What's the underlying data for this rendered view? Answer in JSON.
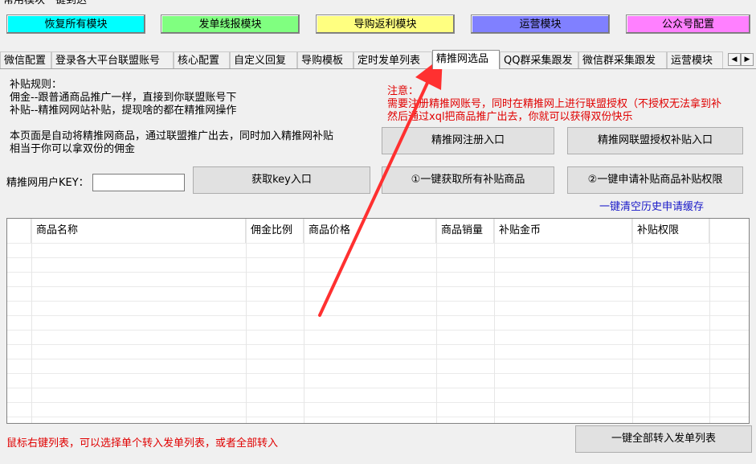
{
  "group_title": "常用模块一键到达",
  "modules": [
    {
      "label": "恢复所有模块",
      "color": "#00ffff"
    },
    {
      "label": "发单线报模块",
      "color": "#80ff80"
    },
    {
      "label": "导购返利模块",
      "color": "#ffff80"
    },
    {
      "label": "运营模块",
      "color": "#8080ff"
    },
    {
      "label": "公众号配置",
      "color": "#ff80ff"
    }
  ],
  "tabs": [
    "微信配置",
    "登录各大平台联盟账号",
    "核心配置",
    "自定义回复",
    "导购模板",
    "定时发单列表",
    "精推网选品",
    "QQ群采集跟发",
    "微信群采集跟发",
    "运营模块"
  ],
  "active_tab": "精推网选品",
  "rules": {
    "title": "补贴规则：",
    "line1": "佣金--跟普通商品推广一样，直接到你联盟账号下",
    "line2": "补贴--精推网网站补贴，提现啥的都在精推网操作"
  },
  "notice": {
    "title": "注意：",
    "line1": "需要注册精推网账号，同时在精推网上进行联盟授权（不授权无法拿到补",
    "line2": "然后通过xql把商品推广出去，你就可以获得双份快乐"
  },
  "desc": {
    "line1": "本页面是自动将精推网商品，通过联盟推广出去，同时加入精推网补贴",
    "line2": "相当于你可以拿双份的佣金"
  },
  "buttons": {
    "register": "精推网注册入口",
    "auth": "精推网联盟授权补贴入口",
    "get_key": "获取key入口",
    "get_all": "①一键获取所有补贴商品",
    "apply": "②一键申请补贴商品补贴权限",
    "transfer_all": "一键全部转入发单列表"
  },
  "key_label": "精推网用户KEY：",
  "key_value": "",
  "clear_cache_link": "一键清空历史申请缓存",
  "table": {
    "columns": [
      "",
      "商品名称",
      "佣金比例",
      "商品价格",
      "商品销量",
      "补贴金币",
      "补贴权限",
      ""
    ]
  },
  "footer_hint": "鼠标右键列表，可以选择单个转入发单列表，或者全部转入",
  "colors": {
    "annotation_arrow": "#ff3030",
    "notice": "#e00000",
    "link": "#1818c8"
  }
}
